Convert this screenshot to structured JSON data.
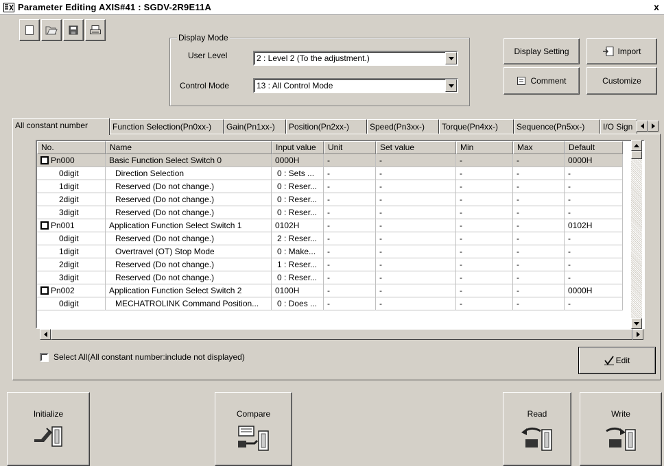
{
  "window": {
    "title": "Parameter Editing  AXIS#41 : SGDV-2R9E11A",
    "close_label": "x"
  },
  "toolbar": {
    "icons": [
      "new-icon",
      "open-icon",
      "save-icon",
      "print-icon"
    ]
  },
  "display_mode": {
    "legend": "Display Mode",
    "user_level_label": "User Level",
    "user_level_value": "2 : Level 2 (To the adjustment.)",
    "control_mode_label": "Control Mode",
    "control_mode_value": "13 : All Control Mode"
  },
  "buttons": {
    "display_setting": "Display Setting",
    "import": "Import",
    "comment": "Comment",
    "customize": "Customize",
    "edit": "Edit",
    "initialize": "Initialize",
    "compare": "Compare",
    "read": "Read",
    "write": "Write"
  },
  "tabs": [
    "All constant number",
    "Function Selection(Pn0xx-)",
    "Gain(Pn1xx-)",
    "Position(Pn2xx-)",
    "Speed(Pn3xx-)",
    "Torque(Pn4xx-)",
    "Sequence(Pn5xx-)",
    "I/O Sign"
  ],
  "table": {
    "columns": [
      "No.",
      "Name",
      "Input value",
      "Unit",
      "Set value",
      "Min",
      "Max",
      "Default"
    ],
    "rows": [
      {
        "group": true,
        "selected": true,
        "no": "Pn000",
        "name": "Basic Function Select Switch 0",
        "input": "0000H",
        "unit": "-",
        "set": "-",
        "min": "-",
        "max": "-",
        "default": "0000H"
      },
      {
        "group": false,
        "no": "0digit",
        "name": "Direction Selection",
        "input": "0 : Sets ...",
        "unit": "-",
        "set": "-",
        "min": "-",
        "max": "-",
        "default": "-"
      },
      {
        "group": false,
        "no": "1digit",
        "name": "Reserved (Do not change.)",
        "input": "0 : Reser...",
        "unit": "-",
        "set": "-",
        "min": "-",
        "max": "-",
        "default": "-"
      },
      {
        "group": false,
        "no": "2digit",
        "name": "Reserved (Do not change.)",
        "input": "0 : Reser...",
        "unit": "-",
        "set": "-",
        "min": "-",
        "max": "-",
        "default": "-"
      },
      {
        "group": false,
        "no": "3digit",
        "name": "Reserved (Do not change.)",
        "input": "0 : Reser...",
        "unit": "-",
        "set": "-",
        "min": "-",
        "max": "-",
        "default": "-"
      },
      {
        "group": true,
        "no": "Pn001",
        "name": "Application Function Select Switch 1",
        "input": "0102H",
        "unit": "-",
        "set": "-",
        "min": "-",
        "max": "-",
        "default": "0102H"
      },
      {
        "group": false,
        "no": "0digit",
        "name": "Reserved (Do not change.)",
        "input": "2 : Reser...",
        "unit": "-",
        "set": "-",
        "min": "-",
        "max": "-",
        "default": "-"
      },
      {
        "group": false,
        "no": "1digit",
        "name": "Overtravel (OT) Stop Mode",
        "input": "0 : Make...",
        "unit": "-",
        "set": "-",
        "min": "-",
        "max": "-",
        "default": "-"
      },
      {
        "group": false,
        "no": "2digit",
        "name": "Reserved (Do not change.)",
        "input": "1 : Reser...",
        "unit": "-",
        "set": "-",
        "min": "-",
        "max": "-",
        "default": "-"
      },
      {
        "group": false,
        "no": "3digit",
        "name": "Reserved (Do not change.)",
        "input": "0 : Reser...",
        "unit": "-",
        "set": "-",
        "min": "-",
        "max": "-",
        "default": "-"
      },
      {
        "group": true,
        "no": "Pn002",
        "name": "Application Function Select Switch 2",
        "input": "0100H",
        "unit": "-",
        "set": "-",
        "min": "-",
        "max": "-",
        "default": "0000H"
      },
      {
        "group": false,
        "no": "0digit",
        "name": "MECHATROLINK Command Position...",
        "input": "0 : Does ...",
        "unit": "-",
        "set": "-",
        "min": "-",
        "max": "-",
        "default": "-"
      }
    ]
  },
  "select_all_label": "Select All(All constant number:include not displayed)"
}
